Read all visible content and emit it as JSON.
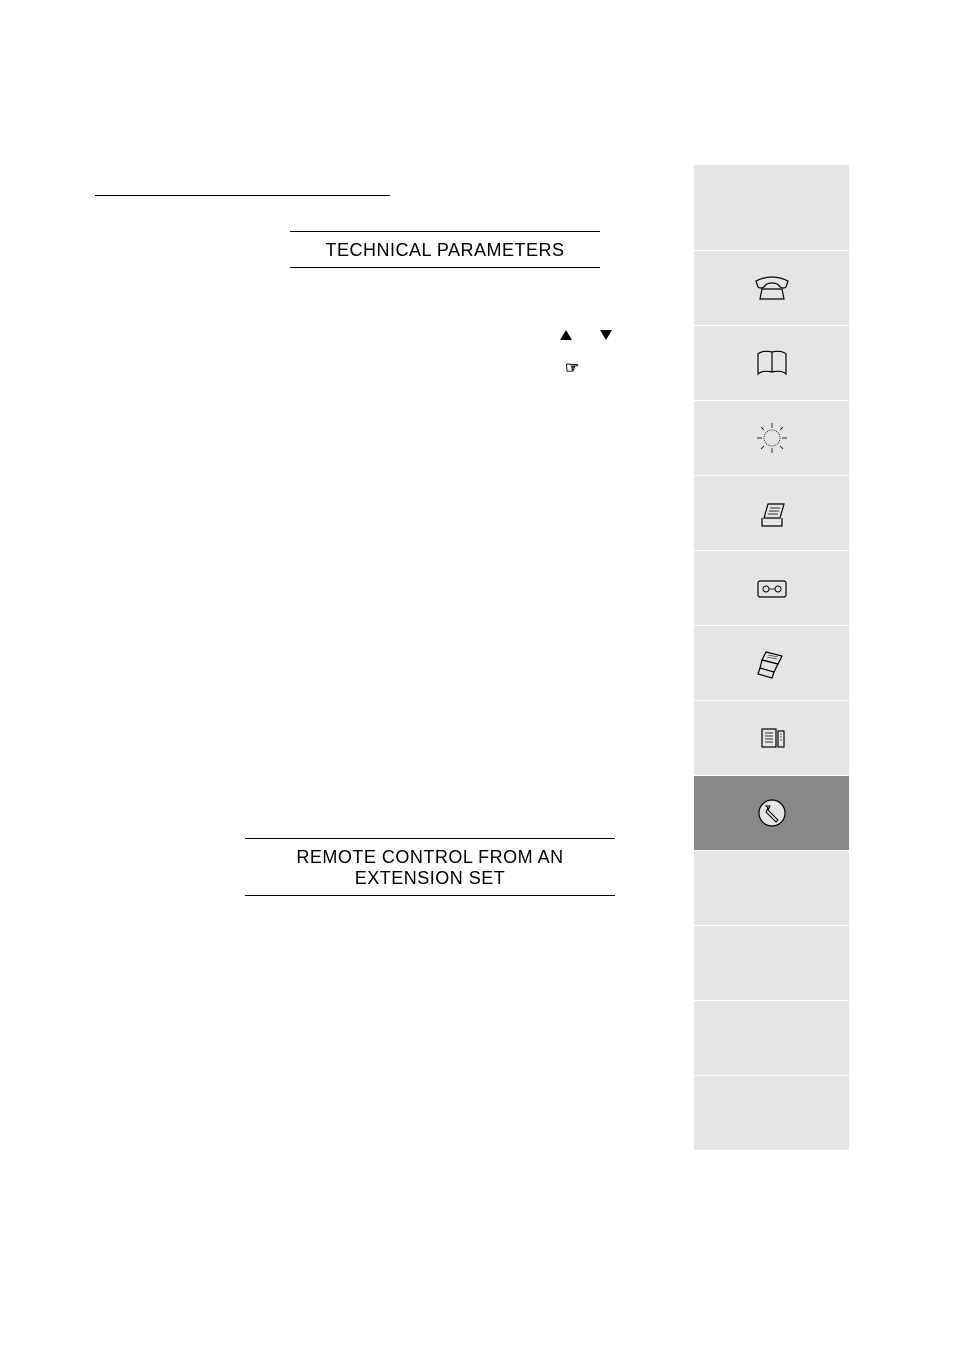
{
  "headings": {
    "technical_parameters": "TECHNICAL PARAMETERS",
    "remote_control": "REMOTE CONTROL FROM AN EXTENSION SET"
  },
  "sidebar": {
    "icons": [
      {
        "name": "telephone-icon",
        "selected": false
      },
      {
        "name": "book-icon",
        "selected": false
      },
      {
        "name": "sun-icon",
        "selected": false
      },
      {
        "name": "fax-tray-icon",
        "selected": false
      },
      {
        "name": "cassette-icon",
        "selected": false
      },
      {
        "name": "printer-icon",
        "selected": false
      },
      {
        "name": "document-stack-icon",
        "selected": false
      },
      {
        "name": "wrench-circle-icon",
        "selected": true
      }
    ]
  },
  "symbols": {
    "pointing_hand": "☞"
  }
}
